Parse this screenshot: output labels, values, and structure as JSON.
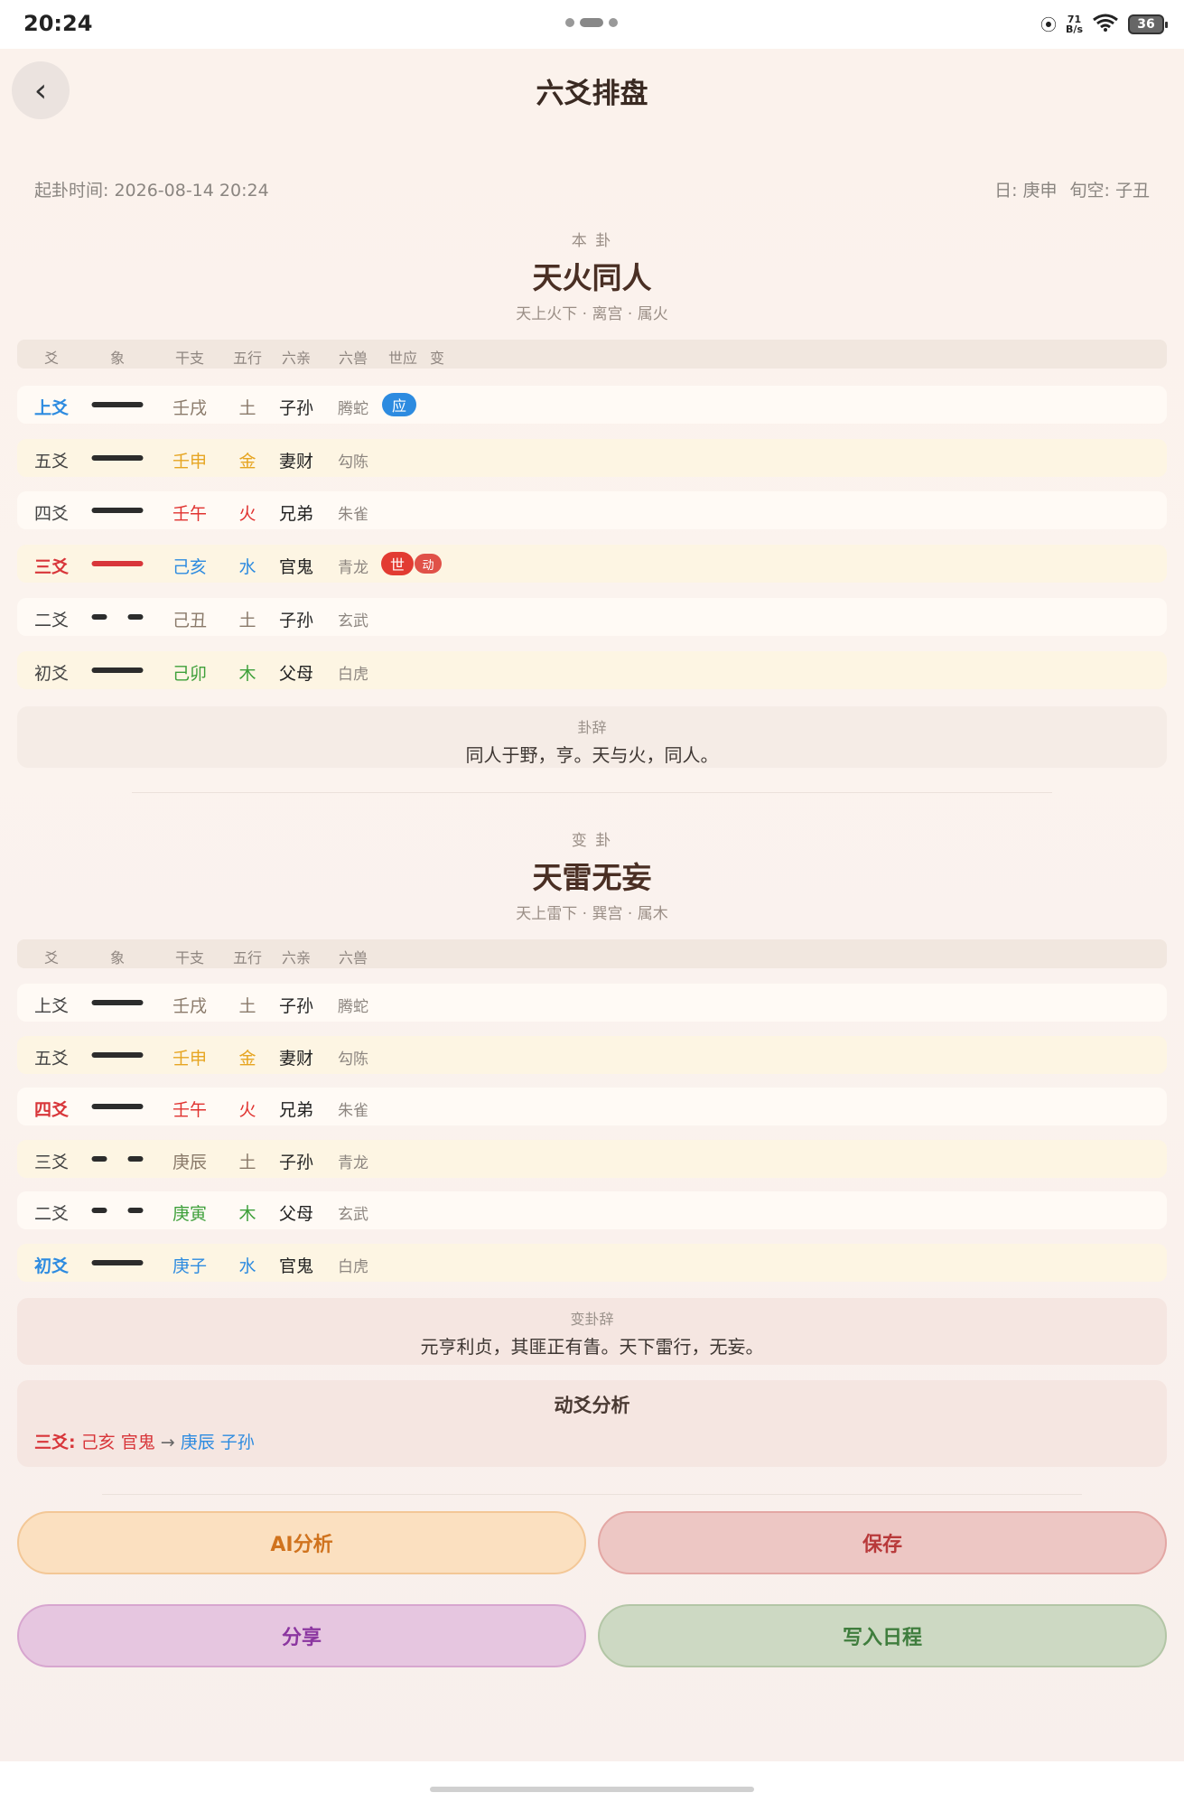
{
  "status_bar": {
    "time": "20:24",
    "net_speed_top": "71",
    "net_speed_bottom": "B/s",
    "wifi_label": "6",
    "battery": "36"
  },
  "header": {
    "back_icon": "‹",
    "title": "六爻排盘"
  },
  "meta": {
    "cast_time": "起卦时间: 2026-08-14 20:24",
    "day": "日: 庚申",
    "void": "旬空: 子丑"
  },
  "main_hex": {
    "caption": "本 卦",
    "name": "天火同人",
    "subtitle": "天上火下 · 离宫 · 属火",
    "headers": [
      "爻",
      "象",
      "干支",
      "五行",
      "六亲",
      "六兽",
      "世应",
      "变"
    ],
    "rows": [
      {
        "pos": "上爻",
        "line": "yang",
        "ganzhi": "壬戌",
        "wuxing": "土",
        "qin": "子孙",
        "beast": "腾蛇",
        "badge": "应"
      },
      {
        "pos": "五爻",
        "line": "yang",
        "ganzhi": "壬申",
        "wuxing": "金",
        "qin": "妻财",
        "beast": "勾陈"
      },
      {
        "pos": "四爻",
        "line": "yang",
        "ganzhi": "壬午",
        "wuxing": "火",
        "qin": "兄弟",
        "beast": "朱雀"
      },
      {
        "pos": "三爻",
        "line": "yang-moving",
        "ganzhi": "己亥",
        "wuxing": "水",
        "qin": "官鬼",
        "beast": "青龙",
        "badge": "世",
        "moving": "动"
      },
      {
        "pos": "二爻",
        "line": "yin",
        "ganzhi": "己丑",
        "wuxing": "土",
        "qin": "子孙",
        "beast": "玄武"
      },
      {
        "pos": "初爻",
        "line": "yang",
        "ganzhi": "己卯",
        "wuxing": "木",
        "qin": "父母",
        "beast": "白虎"
      }
    ],
    "verdict_caption": "卦辞",
    "verdict_text": "同人于野，亨。天与火，同人。"
  },
  "changed_hex": {
    "caption": "变 卦",
    "name": "天雷无妄",
    "subtitle": "天上雷下 · 巽宫 · 属木",
    "headers": [
      "爻",
      "象",
      "干支",
      "五行",
      "六亲",
      "六兽"
    ],
    "rows": [
      {
        "pos": "上爻",
        "line": "yang",
        "ganzhi": "壬戌",
        "wuxing": "土",
        "qin": "子孙",
        "beast": "腾蛇"
      },
      {
        "pos": "五爻",
        "line": "yang",
        "ganzhi": "壬申",
        "wuxing": "金",
        "qin": "妻财",
        "beast": "勾陈"
      },
      {
        "pos": "四爻",
        "line": "yang",
        "ganzhi": "壬午",
        "wuxing": "火",
        "qin": "兄弟",
        "beast": "朱雀"
      },
      {
        "pos": "三爻",
        "line": "yin",
        "ganzhi": "庚辰",
        "wuxing": "土",
        "qin": "子孙",
        "beast": "青龙"
      },
      {
        "pos": "二爻",
        "line": "yin",
        "ganzhi": "庚寅",
        "wuxing": "木",
        "qin": "父母",
        "beast": "玄武"
      },
      {
        "pos": "初爻",
        "line": "yang",
        "ganzhi": "庚子",
        "wuxing": "水",
        "qin": "官鬼",
        "beast": "白虎"
      }
    ],
    "verdict_caption": "变卦辞",
    "verdict_text": "元亨利贞，其匪正有眚。天下雷行，无妄。"
  },
  "moving_analysis": {
    "title": "动爻分析",
    "line": "三爻:",
    "from": "己亥 官鬼",
    "arrow": "→",
    "to": "庚辰 子孙"
  },
  "buttons": {
    "ai": "AI分析",
    "save": "保存",
    "share": "分享",
    "calendar": "写入日程"
  },
  "colors": {
    "earth": "#8a7a6a",
    "metal": "#e6a522",
    "fire": "#e0322f",
    "water": "#2d8be0",
    "wood": "#3ea03a",
    "accent_red": "#d8363a",
    "accent_blue": "#2d8be0"
  }
}
